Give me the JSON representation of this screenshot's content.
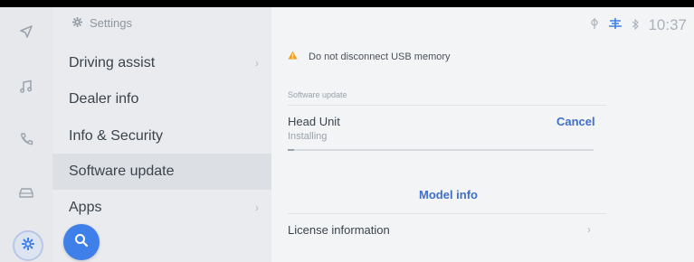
{
  "rail": {
    "icons": [
      "navigation-arrow-icon",
      "music-note-icon",
      "phone-icon",
      "car-icon",
      "gear-icon"
    ]
  },
  "menu": {
    "header": "Settings",
    "items": [
      {
        "label": "Driving assist",
        "chevron": true,
        "selected": false
      },
      {
        "label": "Dealer info",
        "chevron": false,
        "selected": false
      },
      {
        "label": "Info & Security",
        "chevron": false,
        "selected": false
      },
      {
        "label": "Software update",
        "chevron": false,
        "selected": true
      },
      {
        "label": "Apps",
        "chevron": true,
        "selected": false
      }
    ]
  },
  "status": {
    "time": "10:37"
  },
  "content": {
    "warning": "Do not disconnect USB memory",
    "section_label": "Software update",
    "unit_title": "Head Unit",
    "unit_status": "Installing",
    "cancel_label": "Cancel",
    "progress": 0.02,
    "model_info_label": "Model info",
    "license_label": "License information"
  },
  "colors": {
    "accent": "#3f7fe9",
    "link": "#3f6fc9",
    "warning": "#f0a020"
  }
}
